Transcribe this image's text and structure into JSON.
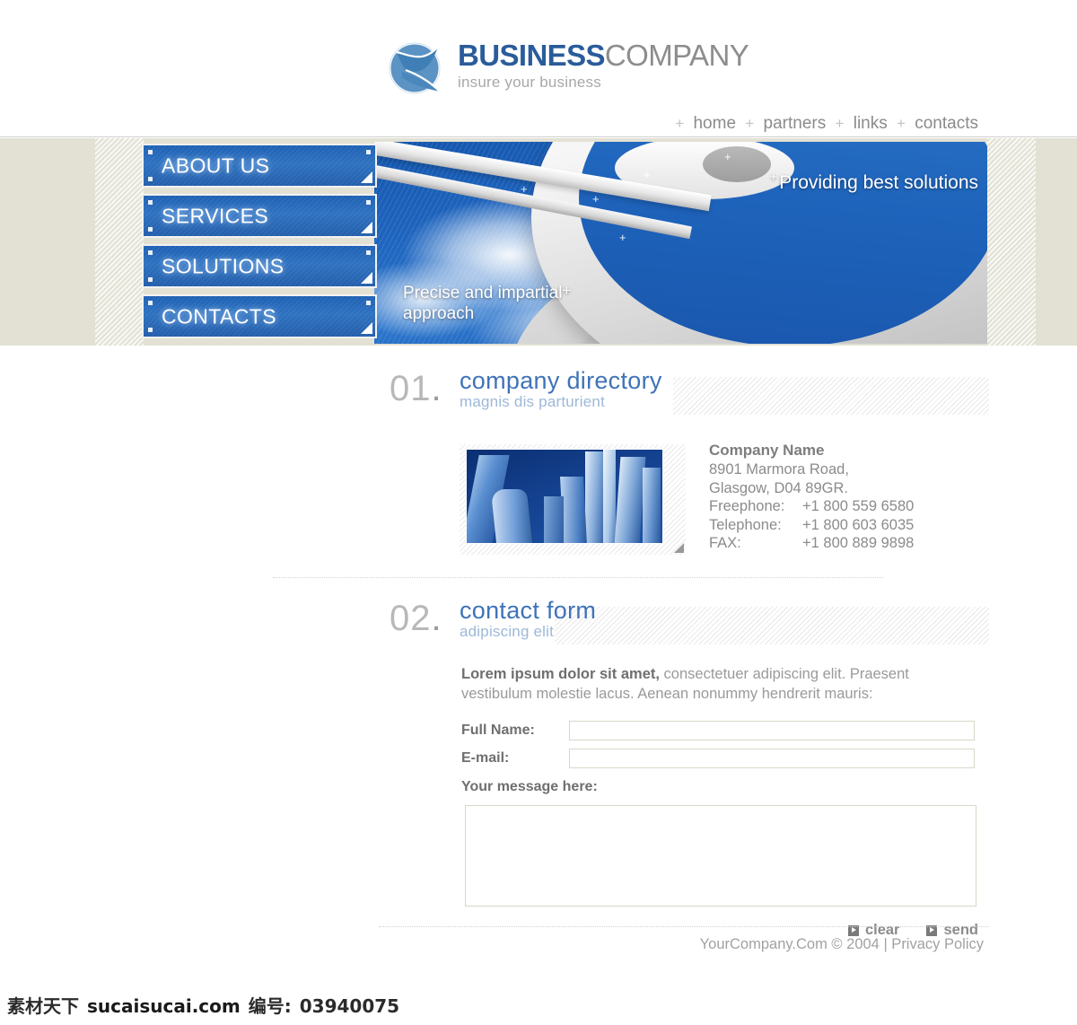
{
  "header": {
    "logo": {
      "icon": "globe-swoosh-logo-icon",
      "title_bold": "BUSINESS",
      "title_light": "COMPANY",
      "tagline": "insure your business"
    },
    "topnav": {
      "separator": "+",
      "items": [
        {
          "label": "home"
        },
        {
          "label": "partners"
        },
        {
          "label": "links"
        },
        {
          "label": "contacts"
        }
      ]
    }
  },
  "banner": {
    "caption_right": "Providing best solutions",
    "caption_right_marker": "+",
    "caption_left_line1": "Precise and impartial",
    "caption_left_line2": "approach",
    "caption_left_marker": "+"
  },
  "sidemenu": {
    "items": [
      {
        "label": "ABOUT US"
      },
      {
        "label": "SERVICES"
      },
      {
        "label": "SOLUTIONS"
      },
      {
        "label": "CONTACTS"
      }
    ]
  },
  "sections": [
    {
      "number": "01",
      "dot": ".",
      "title": "company  directory",
      "subtitle": "magnis dis parturient"
    },
    {
      "number": "02",
      "dot": ".",
      "title": "contact form",
      "subtitle": "adipiscing elit"
    }
  ],
  "directory": {
    "photo_alt": "city-skyscrapers-photo",
    "company_name": "Company Name",
    "address_line1": "8901 Marmora Road,",
    "address_line2": "Glasgow, D04 89GR.",
    "freephone_label": "Freephone:",
    "freephone_value": "+1 800 559 6580",
    "telephone_label": "Telephone:",
    "telephone_value": "+1 800 603 6035",
    "fax_label": "FAX:",
    "fax_value": "+1 800 889 9898"
  },
  "form": {
    "intro_bold": "Lorem ipsum dolor sit amet,",
    "intro_rest": " consectetuer adipiscing elit. Praesent vestibulum molestie lacus. Aenean nonummy hendrerit mauris:",
    "fullname_label": "Full Name:",
    "fullname_value": "",
    "fullname_placeholder": "",
    "email_label": "E-mail:",
    "email_value": "",
    "email_placeholder": "",
    "message_label": "Your message here:",
    "message_value": "",
    "message_placeholder": "",
    "clear_label": "clear",
    "send_label": "send"
  },
  "footer": {
    "text": "YourCompany.Com © 2004 | Privacy Policy"
  },
  "watermark": {
    "cn": "素材天下",
    "site": "sucaisucai.com",
    "id_label": "编号:",
    "id_value": "03940075"
  },
  "colors": {
    "brand_blue": "#2a5c9a",
    "menu_blue": "#2f72c0",
    "heading_blue": "#3f73b8",
    "subtitle_blue": "#9db8d8",
    "band_beige": "#e2e1d4",
    "text_gray": "#8b8b8b",
    "input_border": "#d9d7c8"
  }
}
